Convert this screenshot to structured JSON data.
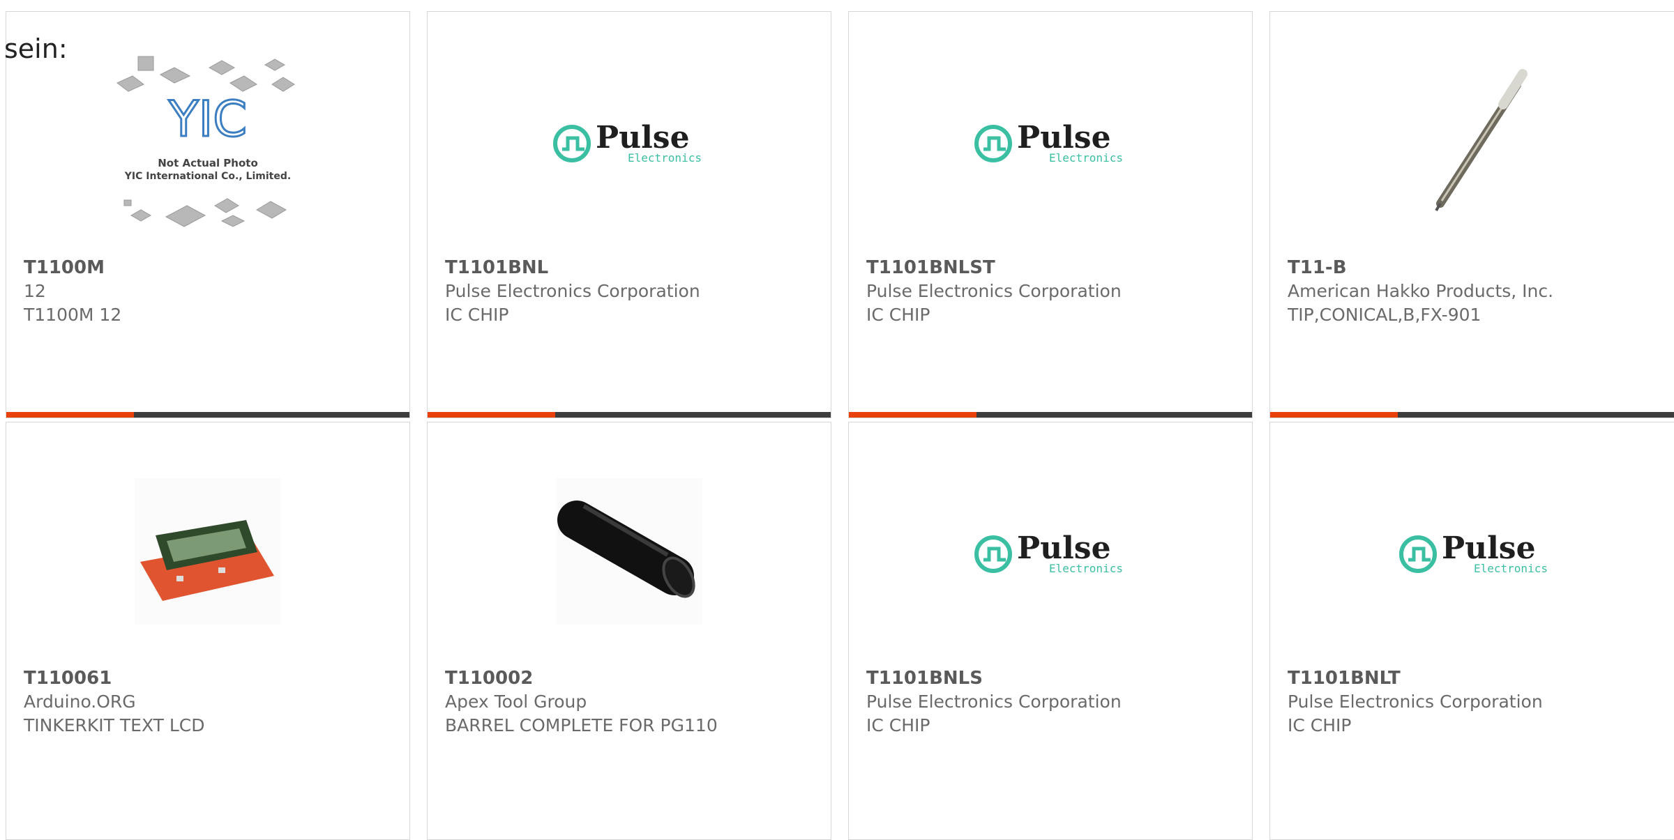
{
  "intro_text": "sein:",
  "accent_color": "#e8410c",
  "bar_color": "#3d3d3d",
  "cards": [
    {
      "part_number": "T1100M",
      "manufacturer": "12",
      "description": "T1100M 12",
      "image": "yic-placeholder-photo",
      "image_text": {
        "brand": "YIC",
        "caption1": "Not Actual Photo",
        "caption2": "YIC International Co., Limited."
      }
    },
    {
      "part_number": "T1101BNL",
      "manufacturer": "Pulse Electronics Corporation",
      "description": "IC CHIP",
      "image": "pulse-electronics-logo",
      "image_text": {
        "brand": "Pulse",
        "sub": "Electronics"
      }
    },
    {
      "part_number": "T1101BNLST",
      "manufacturer": "Pulse Electronics Corporation",
      "description": "IC CHIP",
      "image": "pulse-electronics-logo",
      "image_text": {
        "brand": "Pulse",
        "sub": "Electronics"
      }
    },
    {
      "part_number": "T11-B",
      "manufacturer": "American Hakko Products, Inc.",
      "description": "TIP,CONICAL,B,FX-901",
      "image": "soldering-tip-photo"
    },
    {
      "part_number": "T110061",
      "manufacturer": "Arduino.ORG",
      "description": "TINKERKIT TEXT LCD",
      "image": "lcd-module-photo"
    },
    {
      "part_number": "T110002",
      "manufacturer": "Apex Tool Group",
      "description": "BARREL COMPLETE FOR PG110",
      "image": "black-barrel-photo"
    },
    {
      "part_number": "T1101BNLS",
      "manufacturer": "Pulse Electronics Corporation",
      "description": "IC CHIP",
      "image": "pulse-electronics-logo",
      "image_text": {
        "brand": "Pulse",
        "sub": "Electronics"
      }
    },
    {
      "part_number": "T1101BNLT",
      "manufacturer": "Pulse Electronics Corporation",
      "description": "IC CHIP",
      "image": "pulse-electronics-logo",
      "image_text": {
        "brand": "Pulse",
        "sub": "Electronics"
      }
    }
  ]
}
